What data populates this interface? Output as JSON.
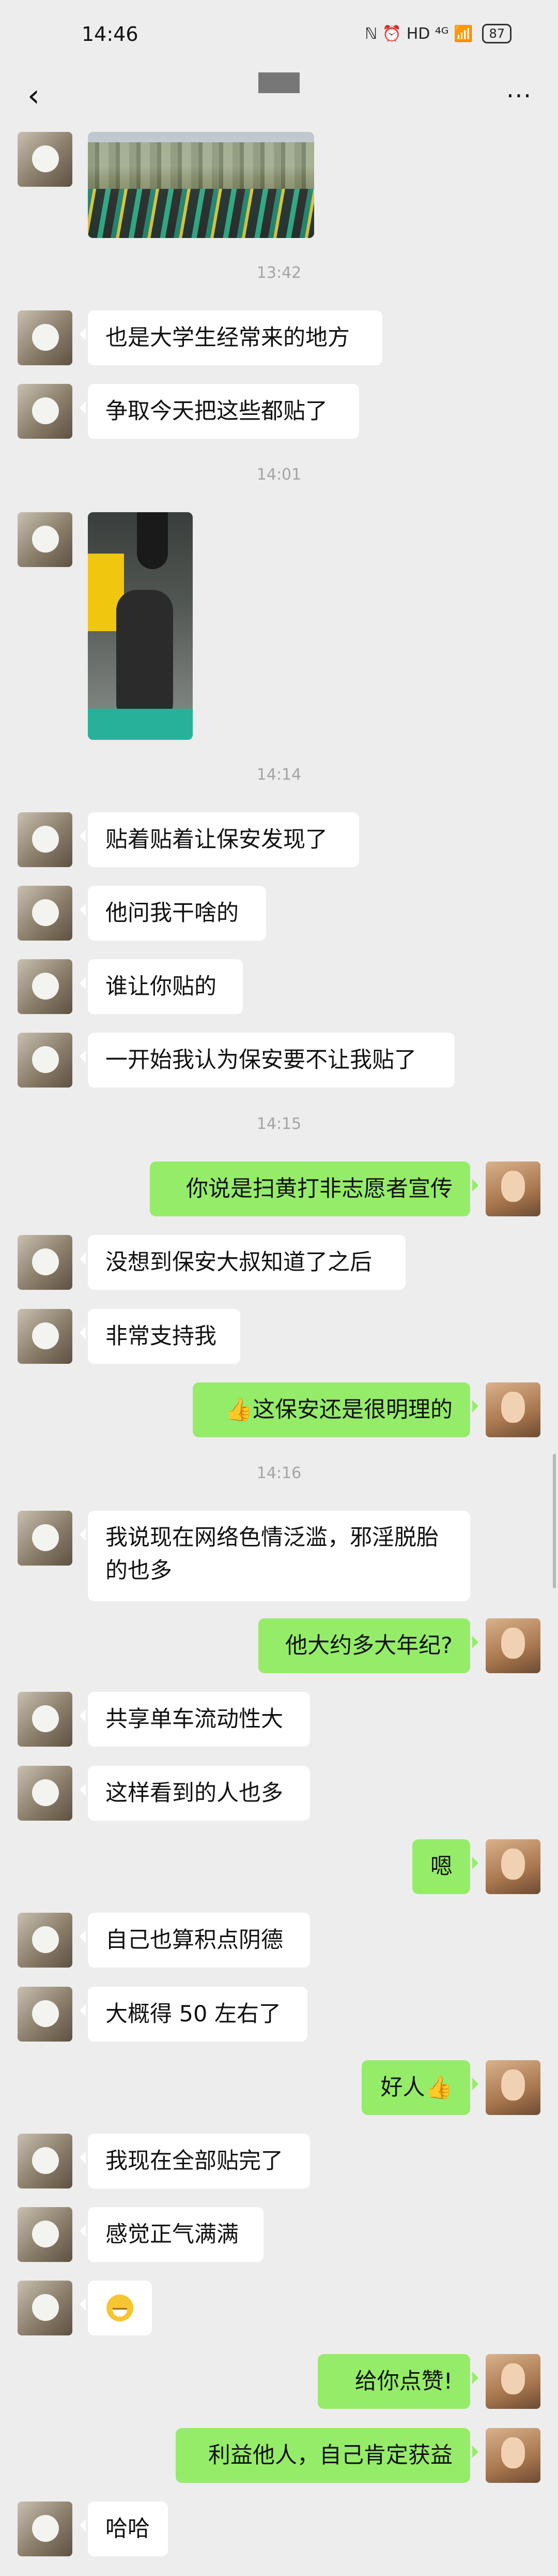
{
  "status": {
    "time": "14:46",
    "icons": "ℕ ⏰ HD ⁴ᴳ 📶",
    "battery": "87"
  },
  "nav": {
    "back_icon": "‹",
    "more_icon": "···"
  },
  "timestamps": [
    "13:42",
    "14:01",
    "14:14",
    "14:15",
    "14:16"
  ],
  "messages": [
    {
      "side": "in",
      "text": "也是大学生经常来的地方"
    },
    {
      "side": "in",
      "text": "争取今天把这些都贴了"
    },
    {
      "side": "in",
      "text": "贴着贴着让保安发现了"
    },
    {
      "side": "in",
      "text": "他问我干啥的"
    },
    {
      "side": "in",
      "text": "谁让你贴的"
    },
    {
      "side": "in",
      "text": "一开始我认为保安要不让我贴了"
    },
    {
      "side": "out",
      "text": "你说是扫黄打非志愿者宣传"
    },
    {
      "side": "in",
      "text": "没想到保安大叔知道了之后"
    },
    {
      "side": "in",
      "text": "非常支持我"
    },
    {
      "side": "out",
      "text": "👍这保安还是很明理的"
    },
    {
      "side": "in",
      "text": "我说现在网络色情泛滥，邪淫脱胎的也多"
    },
    {
      "side": "out",
      "text": "他大约多大年纪?"
    },
    {
      "side": "in",
      "text": "共享单车流动性大"
    },
    {
      "side": "in",
      "text": "这样看到的人也多"
    },
    {
      "side": "out",
      "text": "嗯"
    },
    {
      "side": "in",
      "text": "自己也算积点阴德"
    },
    {
      "side": "in",
      "text": "大概得 50 左右了"
    },
    {
      "side": "out",
      "text": "好人👍"
    },
    {
      "side": "in",
      "text": "我现在全部贴完了"
    },
    {
      "side": "in",
      "text": "感觉正气满满"
    },
    {
      "side": "out",
      "text": "给你点赞!"
    },
    {
      "side": "out",
      "text": "利益他人，自己肯定获益"
    },
    {
      "side": "in",
      "text": "哈哈"
    }
  ]
}
